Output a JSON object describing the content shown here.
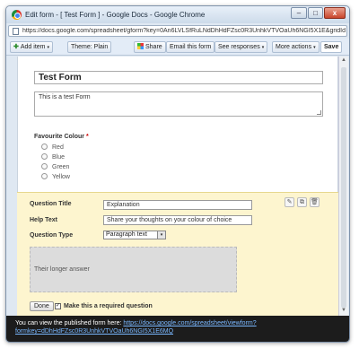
{
  "window": {
    "title": "Edit form - [ Test Form ] - Google Docs - Google Chrome",
    "minimize": "–",
    "maximize": "□",
    "close": "x"
  },
  "address": {
    "url": "https://docs.google.com/spreadsheet/gform?key=0An6LVLSfRuLNdDhHdFZsc0R3UnhkVTVOaUh6NGI5X1E&gridId=0#edit"
  },
  "toolbar": {
    "add_item": "Add item",
    "theme": "Theme:  Plain",
    "share": "Share",
    "email": "Email this form",
    "see_responses": "See responses",
    "more_actions": "More actions",
    "save": "Save",
    "caret": "▾"
  },
  "form": {
    "title": "Test Form",
    "description": "This is a test Form"
  },
  "question": {
    "title": "Favourite Colour",
    "required_mark": "*",
    "options": [
      "Red",
      "Blue",
      "Green",
      "Yellow"
    ]
  },
  "editor": {
    "title_label": "Question Title",
    "title_value": "Explanation",
    "help_label": "Help Text",
    "help_value": "Share your thoughts on your colour of choice",
    "type_label": "Question Type",
    "type_value": "Paragraph text",
    "preview_text": "Their longer answer",
    "done": "Done",
    "required_label": "Make this a required question",
    "required_checked": "✓"
  },
  "notice": {
    "prefix": "You can view the published form here:",
    "link": "https://docs.google.com/spreadsheet/viewform?formkey=dDhHdFZsc0R3UnhkVTVOaUh6NGI5X1E6MQ"
  },
  "icons": [
    "chrome-icon",
    "page-icon",
    "add-icon",
    "share-icon",
    "edit-icon",
    "duplicate-icon",
    "delete-icon",
    "resize-icon"
  ]
}
